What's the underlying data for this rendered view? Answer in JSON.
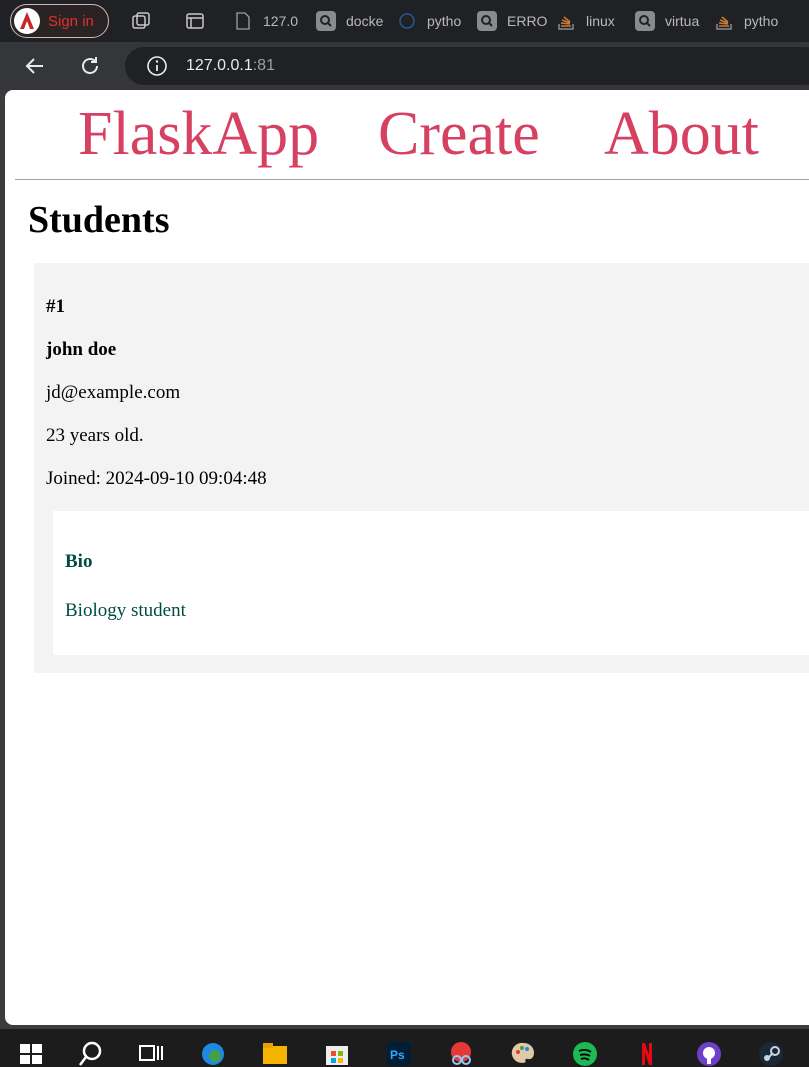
{
  "browser": {
    "signin_label": "Sign in",
    "tabs": [
      {
        "title": "127.0",
        "favicon": "doc-icon"
      },
      {
        "title": "docke",
        "favicon": "search-icon"
      },
      {
        "title": "pytho",
        "favicon": "circle-icon"
      },
      {
        "title": "ERRO",
        "favicon": "search-icon"
      },
      {
        "title": "linux",
        "favicon": "stack-icon"
      },
      {
        "title": "virtua",
        "favicon": "search-icon"
      },
      {
        "title": "pytho",
        "favicon": "stack-icon"
      }
    ],
    "url_host": "127.0.0.1",
    "url_port": ":81"
  },
  "nav": {
    "brand": "FlaskApp",
    "create": "Create",
    "about": "About"
  },
  "page": {
    "title": "Students"
  },
  "student": {
    "id": "#1",
    "name": "john doe",
    "email": "jd@example.com",
    "age": "23 years old.",
    "joined": "Joined: 2024-09-10 09:04:48",
    "bio_heading": "Bio",
    "bio_text": "Biology student"
  },
  "colors": {
    "link": "#d64161",
    "bio_text": "#004d40",
    "card_bg": "#f3f3f3"
  }
}
